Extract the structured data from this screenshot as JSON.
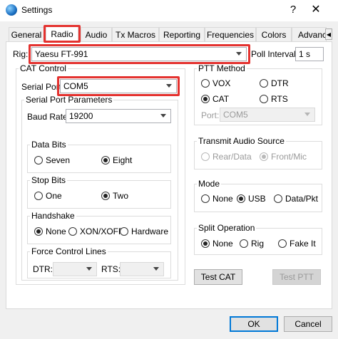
{
  "window": {
    "title": "Settings",
    "help_glyph": "?",
    "close_glyph": "✕"
  },
  "tabs": [
    {
      "label": "General"
    },
    {
      "label": "Radio"
    },
    {
      "label": "Audio"
    },
    {
      "label": "Tx Macros"
    },
    {
      "label": "Reporting"
    },
    {
      "label": "Frequencies"
    },
    {
      "label": "Colors"
    },
    {
      "label": "Advanced"
    }
  ],
  "rig": {
    "label": "Rig:",
    "value": "Yaesu FT-991",
    "poll_label": "Poll Interval:",
    "poll_value": "1 s"
  },
  "cat_control": {
    "title": "CAT Control",
    "serial_port_label": "Serial Port:",
    "serial_port_value": "COM5",
    "params_title": "Serial Port Parameters",
    "baud_label": "Baud Rate:",
    "baud_value": "19200",
    "data_bits": {
      "title": "Data Bits",
      "options": [
        "Seven",
        "Eight"
      ],
      "selected": "Eight"
    },
    "stop_bits": {
      "title": "Stop Bits",
      "options": [
        "One",
        "Two"
      ],
      "selected": "Two"
    },
    "handshake": {
      "title": "Handshake",
      "options": [
        "None",
        "XON/XOFF",
        "Hardware"
      ],
      "selected": "None"
    },
    "force_lines": {
      "title": "Force Control Lines",
      "dtr_label": "DTR:",
      "rts_label": "RTS:",
      "dtr_value": "",
      "rts_value": ""
    }
  },
  "ptt": {
    "title": "PTT Method",
    "options": [
      "VOX",
      "DTR",
      "CAT",
      "RTS"
    ],
    "selected": "CAT",
    "port_label": "Port:",
    "port_value": "COM5"
  },
  "tx_audio": {
    "title": "Transmit Audio Source",
    "options": [
      "Rear/Data",
      "Front/Mic"
    ],
    "selected": "Front/Mic"
  },
  "mode": {
    "title": "Mode",
    "options": [
      "None",
      "USB",
      "Data/Pkt"
    ],
    "selected": "USB"
  },
  "split": {
    "title": "Split Operation",
    "options": [
      "None",
      "Rig",
      "Fake It"
    ],
    "selected": "None"
  },
  "buttons": {
    "test_cat": "Test CAT",
    "test_ptt": "Test PTT",
    "ok": "OK",
    "cancel": "Cancel"
  },
  "colors": {
    "highlight": "#e4322f",
    "default_button": "#0078d7"
  }
}
